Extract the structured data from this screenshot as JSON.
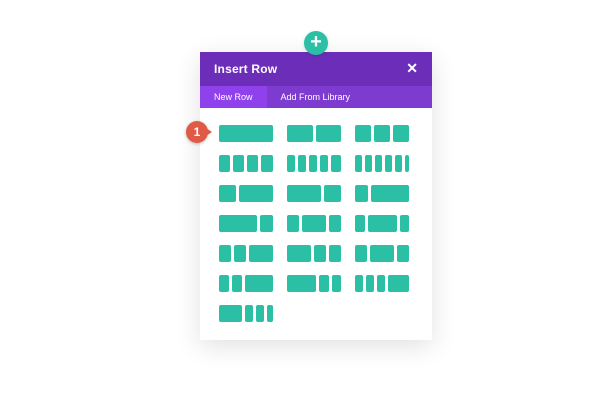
{
  "add_button": {
    "icon": "plus-icon",
    "glyph": "+"
  },
  "modal": {
    "title": "Insert Row",
    "close_glyph": "✕",
    "tabs": [
      {
        "label": "New Row",
        "active": true
      },
      {
        "label": "Add From Library",
        "active": false
      }
    ]
  },
  "callout": {
    "label": "1"
  },
  "colors": {
    "header": "#6c2eb9",
    "tab_bar": "#7e3bd0",
    "active_tab": "#8f42ec",
    "layout_block": "#2bbfa5",
    "add_button": "#2bbfa5",
    "callout": "#e05a46"
  },
  "row_layouts": [
    {
      "name": "one-column",
      "columns": [
        1
      ]
    },
    {
      "name": "two-columns",
      "columns": [
        1,
        1
      ]
    },
    {
      "name": "three-columns",
      "columns": [
        1,
        1,
        1
      ]
    },
    {
      "name": "four-columns",
      "columns": [
        1,
        1,
        1,
        1
      ]
    },
    {
      "name": "five-columns",
      "columns": [
        1,
        1,
        1,
        1,
        1
      ]
    },
    {
      "name": "six-columns",
      "columns": [
        1,
        1,
        1,
        1,
        1,
        1
      ]
    },
    {
      "name": "one-third-two-thirds",
      "columns": [
        1,
        2
      ]
    },
    {
      "name": "two-thirds-one-third",
      "columns": [
        2,
        1
      ]
    },
    {
      "name": "one-quarter-three-quarters",
      "columns": [
        1,
        3
      ]
    },
    {
      "name": "three-quarters-one-quarter",
      "columns": [
        3,
        1
      ]
    },
    {
      "name": "one-quarter-half-one-quarter",
      "columns": [
        1,
        2,
        1
      ]
    },
    {
      "name": "one-fifth-three-fifths-one-fifth",
      "columns": [
        1,
        3,
        1
      ]
    },
    {
      "name": "one-quarter-one-quarter-half",
      "columns": [
        1,
        1,
        2
      ]
    },
    {
      "name": "half-one-quarter-one-quarter",
      "columns": [
        2,
        1,
        1
      ]
    },
    {
      "name": "one-quarter-half-one-quarter-b",
      "columns": [
        1,
        2,
        1
      ]
    },
    {
      "name": "one-fifth-one-fifth-three-fifths",
      "columns": [
        1,
        1,
        3
      ]
    },
    {
      "name": "three-fifths-one-fifth-one-fifth",
      "columns": [
        3,
        1,
        1
      ]
    },
    {
      "name": "one-sixth-one-sixth-one-sixth-half",
      "columns": [
        1,
        1,
        1,
        3
      ]
    },
    {
      "name": "half-one-sixth-one-sixth-one-sixth",
      "columns": [
        3,
        1,
        1,
        1
      ]
    }
  ]
}
